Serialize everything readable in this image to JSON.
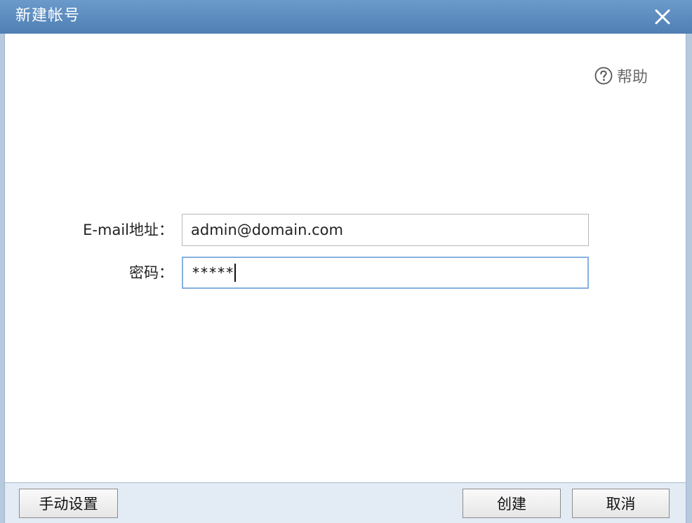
{
  "window": {
    "title": "新建帐号"
  },
  "help": {
    "label": "帮助"
  },
  "form": {
    "email": {
      "label": "E-mail地址：",
      "value": "admin@domain.com"
    },
    "password": {
      "label": "密码：",
      "masked_value": "*****"
    }
  },
  "footer": {
    "manual_setup_label": "手动设置",
    "create_label": "创建",
    "cancel_label": "取消"
  },
  "colors": {
    "titlebar": "#5c8cc2",
    "focus_border": "#86b1e0",
    "footer_bg": "#e3ebf4"
  },
  "icons": {
    "close": "close-icon",
    "help": "help-circle-icon"
  }
}
